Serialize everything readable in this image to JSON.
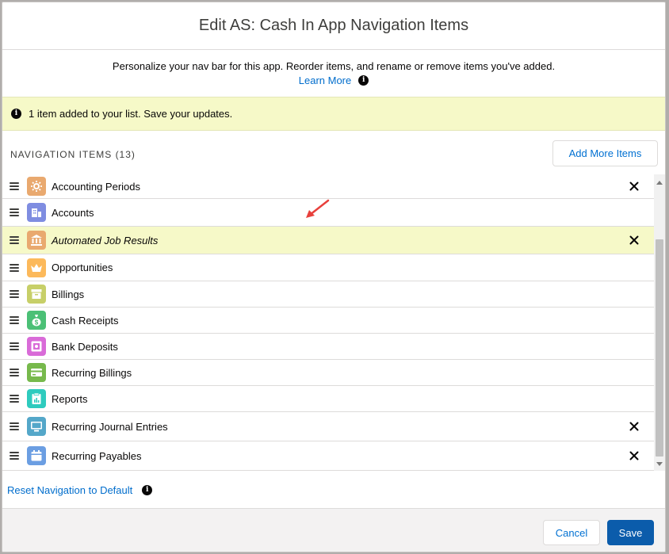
{
  "modal": {
    "title": "Edit AS: Cash In App Navigation Items",
    "description": "Personalize your nav bar for this app. Reorder items, and rename or remove items you've added.",
    "learn_more": "Learn More"
  },
  "banner": {
    "message": "1 item added to your list. Save your updates."
  },
  "nav": {
    "heading": "NAVIGATION ITEMS (13)",
    "add_more_label": "Add More Items",
    "items": [
      {
        "label": "Accounting Periods",
        "icon": "gear-icon",
        "color": "#e9a96f",
        "removable": true,
        "highlight": false,
        "italic": false
      },
      {
        "label": "Accounts",
        "icon": "building-icon",
        "color": "#7f8de1",
        "removable": false,
        "highlight": false,
        "italic": false
      },
      {
        "label": "Automated Job Results",
        "icon": "bank-icon",
        "color": "#e9a96f",
        "removable": true,
        "highlight": true,
        "italic": true
      },
      {
        "label": "Opportunities",
        "icon": "crown-icon",
        "color": "#fcb95b",
        "removable": false,
        "highlight": false,
        "italic": false
      },
      {
        "label": "Billings",
        "icon": "archive-icon",
        "color": "#c7cf68",
        "removable": false,
        "highlight": false,
        "italic": false
      },
      {
        "label": "Cash Receipts",
        "icon": "money-bag-icon",
        "color": "#4bc076",
        "removable": false,
        "highlight": false,
        "italic": false
      },
      {
        "label": "Bank Deposits",
        "icon": "safe-icon",
        "color": "#d96bd8",
        "removable": false,
        "highlight": false,
        "italic": false
      },
      {
        "label": "Recurring Billings",
        "icon": "card-icon",
        "color": "#77b94c",
        "removable": false,
        "highlight": false,
        "italic": false
      },
      {
        "label": "Reports",
        "icon": "report-icon",
        "color": "#2ecbbe",
        "removable": false,
        "highlight": false,
        "italic": false
      },
      {
        "label": "Recurring Journal Entries",
        "icon": "monitor-icon",
        "color": "#54a7c9",
        "removable": true,
        "highlight": false,
        "italic": false
      },
      {
        "label": "Recurring Payables",
        "icon": "calendar-icon",
        "color": "#6b9ee2",
        "removable": true,
        "highlight": false,
        "italic": false
      }
    ]
  },
  "reset_label": "Reset Navigation to Default",
  "footer": {
    "cancel_label": "Cancel",
    "save_label": "Save"
  },
  "colors": {
    "link": "#006dcc",
    "brand_button": "#0b5cab",
    "highlight": "#f6f9c8",
    "annotation_arrow": "#e8403c"
  }
}
